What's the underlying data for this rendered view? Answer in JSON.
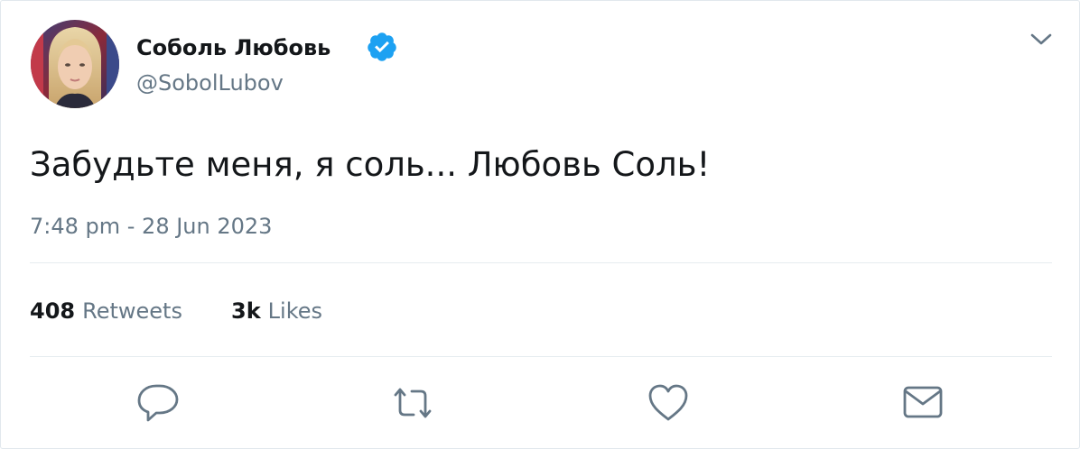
{
  "author": {
    "display_name": "Соболь Любовь",
    "handle": "@SobolLubov",
    "verified": true
  },
  "tweet": {
    "text": "Забудьте меня, я соль... Любовь Соль!",
    "timestamp": "7:48 pm - 28 Jun 2023"
  },
  "stats": {
    "retweets_count": "408",
    "retweets_label": "Retweets",
    "likes_count": "3k",
    "likes_label": "Likes"
  },
  "actions": {
    "reply_icon": "speech-bubble-icon",
    "retweet_icon": "retweet-icon",
    "like_icon": "heart-icon",
    "dm_icon": "envelope-icon"
  },
  "colors": {
    "text_primary": "#14171a",
    "text_secondary": "#657786",
    "verified_blue": "#1da1f2",
    "divider": "#e6ecf0"
  }
}
